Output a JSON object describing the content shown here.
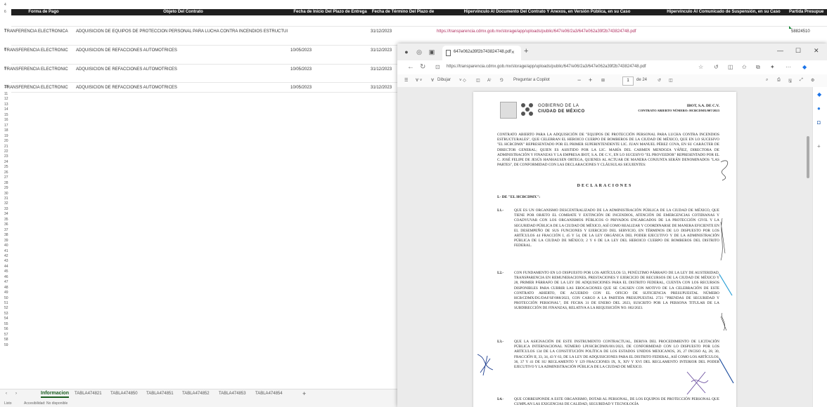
{
  "spreadsheet": {
    "row_numbers": [
      "4",
      "6",
      "7",
      "8",
      "9",
      "10",
      "11",
      "12",
      "13",
      "14",
      "15",
      "16",
      "17",
      "18",
      "19",
      "20",
      "21",
      "22",
      "23",
      "24",
      "25",
      "26",
      "27",
      "28",
      "29",
      "30",
      "31",
      "32",
      "33",
      "34",
      "35",
      "36",
      "37",
      "38",
      "39",
      "40",
      "41",
      "42",
      "43",
      "44",
      "45",
      "46",
      "47",
      "48",
      "49",
      "50",
      "51",
      "52",
      "53",
      "54",
      "55",
      "56",
      "57",
      "58",
      "59"
    ],
    "headers": {
      "forma_pago": "Forma de Pago",
      "objeto": "Objeto Del Contrato",
      "fecha_inicio": "Fecha de Inicio Del Plazo de Entrega",
      "fecha_termino": "Fecha de Término Del Plazo de",
      "hipervinculo_doc": "Hipervínculo Al Documento Del Contrato Y Anexos, en Versión Pública, en su Caso",
      "hipervinculo_susp": "Hipervínculo Al Comunicado de Suspensión, en su Caso",
      "partida": "Partida Presupue"
    },
    "rows": [
      {
        "pago": "TRANFERENCIA ELECTRONICA",
        "objeto": "ADQUISICION DE EQUIPOS DE PROTECCION PERSONAL PARA LUCHA CONTRA INCENDIOS ESTRUCTUI",
        "inicio": "",
        "termino": "31/12/2023",
        "link": "https://transparencia.cdmx.gob.mx/storage/app/uploads/public/647/e06/2a3/647e062a39f2b743824748.pdf",
        "partida": "58824510"
      },
      {
        "pago": "TRANSFERENCIA ELECTRONIC",
        "objeto": "ADQUISICION DE REFACCIONES AUTOMOTRICES",
        "inicio": "10/05/2023",
        "termino": "31/12/2023",
        "link": "",
        "partida": ""
      },
      {
        "pago": "TRANSFERENCIA ELECTRONIC",
        "objeto": "ADQUISICION DE REFACCIONES AUTOMOTRICES",
        "inicio": "10/05/2023",
        "termino": "31/12/2023",
        "link": "",
        "partida": ""
      },
      {
        "pago": "TRANSFERENCIA ELECTRONIC",
        "objeto": "ADQUISICION DE REFACCIONES AUTOMOTRICES",
        "inicio": "10/05/2023",
        "termino": "31/12/2023",
        "link": "",
        "partida": ""
      }
    ],
    "sheet_tabs": [
      "Informacion",
      "TABLA474821",
      "TABLA474850",
      "TABLA474851",
      "TABLA474852",
      "TABLA474853",
      "TABLA474854"
    ],
    "add_tab": "+",
    "status_ready": "Listo",
    "status_accessibility": "Accesibilidad: No disponible"
  },
  "browser": {
    "tab_title": "647e062a39f2b743824748.pdf",
    "tab_close": "×",
    "new_tab": "+",
    "url": "https://transparencia.cdmx.gob.mx/storage/app/uploads/public/647/e06/2a3/647e062a39f2b743824748.pdf",
    "pdf_toolbar": {
      "draw": "Dibujar",
      "copilot": "Preguntar a Copilot",
      "page": "1",
      "of_pages": "de 24"
    }
  },
  "pdf": {
    "gov_line1": "GOBIERNO DE LA",
    "gov_line2": "CIUDAD DE MÉXICO",
    "header_right1": "IBOT, S.A. DE C.V.",
    "header_right2": "CONTRATO ABIERTO NÚMERO: HCBCDMX/007/2023",
    "intro": "CONTRATO ABIERTO PARA LA ADQUISICIÓN DE \"EQUIPOS DE PROTECCIÓN PERSONAL PARA LUCHA CONTRA INCENDIOS ESTRUCTURALES\", QUE CELEBRAN EL HEROICO CUERPO DE BOMBEROS DE LA CIUDAD DE MÉXICO, QUE EN LO SUCESIVO \"EL HCBCDMX\" REPRESENTADO POR EL PRIMER SUPERINTENDENTE LIC. JUAN MANUEL PÉREZ COVA, EN SU CARÁCTER DE DIRECTOR GENERAL; QUIEN ES ASISTIDO POR LA LIC. MARÍA DEL CARMEN MENDOZA YÁÑEZ, DIRECTORA DE ADMINISTRACIÓN Y FINANZAS Y LA EMPRESA IBOT, S.A. DE C.V., EN LO SUCESIVO \"EL PROVEEDOR\" REPRESENTADO POR EL C. JOSÉ FELIPE DE JESÚS HANHAUSEN ORTEGA, QUIENES AL ACTUAR DE MANERA CONJUNTA SERÁN DENOMINADOS \"LAS PARTES\", DE CONFORMIDAD CON LAS DECLARACIONES Y CLÁUSULAS SIGUIENTES:",
    "declaraciones": "DECLARACIONES",
    "section_i": "I.- DE \"EL HCBCDMX\":",
    "items": [
      {
        "num": "I.1.-",
        "text": "QUE ES UN ORGANISMO DESCENTRALIZADO DE LA ADMINISTRACIÓN PÚBLICA DE LA CIUDAD DE MÉXICO, QUE TIENE POR OBJETO EL COMBATE Y EXTINCIÓN DE INCENDIOS, ATENCIÓN DE EMERGENCIAS COTIDIANAS Y COADYUVAR CON LOS ORGANISMOS PÚBLICOS O PRIVADOS ENCARGADOS DE LA PROTECCIÓN CIVIL Y LA SEGURIDAD PÚBLICA DE LA CIUDAD DE MÉXICO, ASÍ COMO REALIZAR Y COORDINARSE DE MANERA EFICIENTE EN EL DESEMPEÑO DE SUS FUNCIONES Y EJERCICIO DEL SERVICIO, EN TÉRMINOS DE LO DISPUESTO POR LOS ARTÍCULOS 44 FRACCIÓN I, 45 Y 54, DE LA LEY ORGÁNICA DEL PODER EJECUTIVO Y DE LA ADMINISTRACIÓN PÚBLICA DE LA CIUDAD DE MÉXICO; 2 Y 6 DE LA LEY DEL HEROICO CUERPO DE BOMBEROS DEL DISTRITO FEDERAL."
      },
      {
        "num": "I.2.-",
        "text": "CON FUNDAMENTO EN LO DISPUESTO POR LOS ARTÍCULOS 53, PENÚLTIMO PÁRRAFO DE LA LEY DE AUSTERIDAD, TRANSPARENCIA EN REMUNERACIONES, PRESTACIONES Y EJERCICIO DE RECURSOS DE LA CIUDAD DE MÉXICO Y 28, PRIMER PÁRRAFO DE LA LEY DE ADQUISICIONES PARA EL DISTRITO FEDERAL, CUENTA CON LOS RECURSOS DISPONIBLES PARA CUBRIR LAS EROGACIONES QUE SE CAUSEN CON MOTIVO DE LA CELEBRACIÓN DE ESTE CONTRATO ABIERTO, DE ACUERDO CON EL OFICIO DE SUFICIENCIA PRESUPUESTAL NÚMERO HCB/CDMX/DG/DAF/SF/088/2023, CON CARGO A LA PARTIDA PRESUPUESTAL 2721 \"PRENDAS DE SEGURIDAD Y PROTECCIÓN PERSONAL\", DE FECHA 31 DE ENERO DEL 2023, SUSCRITO POR LA PERSONA TITULAR DE LA SUBDIRECCIÓN DE FINANZAS, RELATIVA A LA REQUISICIÓN NO. 002/2023."
      },
      {
        "num": "I.3.-",
        "text": "QUE LA ASIGNACIÓN DE ESTE INSTRUMENTO CONTRACTUAL, DERIVA DEL PROCEDIMIENTO DE LICITACIÓN PÚBLICA INTERNACIONAL NÚMERO LPI/HCBCDMX/001/2023, DE CONFORMIDAD CON LO DISPUESTO POR LOS ARTÍCULOS 134 DE LA CONSTITUCIÓN POLÍTICA DE LOS ESTADOS UNIDOS MEXICANOS, 26, 27 INCISO A), 28, 30, FRACCIÓN II, 33, 34, 43 Y 63, DE LA LEY DE ADQUISICIONES PARA EL DISTRITO FEDERAL, ASÍ COMO LOS ARTÍCULOS, 36, 37 Y 41 DE SU REGLAMENTO Y 129 FRACCIONES IX, X, XIV Y XVI DEL REGLAMENTO INTERIOR DEL PODER EJECUTIVO Y LA ADMINISTRACIÓN PÚBLICA DE LA CIUDAD DE MÉXICO."
      },
      {
        "num": "I.4.-",
        "text": "QUE CORRESPONDE A ESTE ORGANISMO, DOTAR AL PERSONAL, DE LOS EQUIPOS DE PROTECCIÓN PERSONAL QUE CUMPLAN LAS EXIGENCIAS DE CALIDAD, SEGURIDAD Y TECNOLOGÍA"
      }
    ]
  }
}
